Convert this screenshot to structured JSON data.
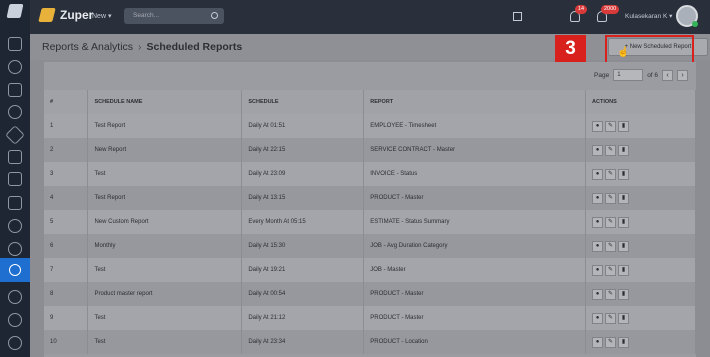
{
  "topbar": {
    "brand": "Zuper",
    "new_label": "New ▾",
    "search_placeholder": "Search...",
    "notif_count_1": "14",
    "notif_count_2": "2000",
    "user_name": "Kulasekaran K ▾"
  },
  "header": {
    "breadcrumb_root": "Reports & Analytics",
    "separator": "›",
    "page_title": "Scheduled Reports",
    "new_button_label": "+ New Scheduled Report"
  },
  "annotation": {
    "step": "3"
  },
  "pagination": {
    "label": "Page",
    "current": "1",
    "total": "of 6"
  },
  "table": {
    "columns": [
      "#",
      "SCHEDULE NAME",
      "SCHEDULE",
      "REPORT",
      "ACTIONS"
    ],
    "rows": [
      {
        "num": "1",
        "name": "Test Report",
        "schedule": "Daily At 01:51",
        "report": "EMPLOYEE - Timesheet"
      },
      {
        "num": "2",
        "name": "New Report",
        "schedule": "Daily At 22:15",
        "report": "SERVICE CONTRACT - Master"
      },
      {
        "num": "3",
        "name": "Test",
        "schedule": "Daily At 23:09",
        "report": "INVOICE - Status"
      },
      {
        "num": "4",
        "name": "Test Report",
        "schedule": "Daily At 13:15",
        "report": "PRODUCT - Master"
      },
      {
        "num": "5",
        "name": "New Custom Report",
        "schedule": "Every Month At 05:15",
        "report": "ESTIMATE - Status Summary"
      },
      {
        "num": "6",
        "name": "Monthly",
        "schedule": "Daily At 15:30",
        "report": "JOB - Avg Duration Category"
      },
      {
        "num": "7",
        "name": "Test",
        "schedule": "Daily At 19:21",
        "report": "JOB - Master"
      },
      {
        "num": "8",
        "name": "Product master report",
        "schedule": "Daily At 00:54",
        "report": "PRODUCT - Master"
      },
      {
        "num": "9",
        "name": "Test",
        "schedule": "Daily At 21:12",
        "report": "PRODUCT - Master"
      },
      {
        "num": "10",
        "name": "Test",
        "schedule": "Daily At 23:34",
        "report": "PRODUCT - Location"
      }
    ]
  },
  "icons": {
    "view": "eye-icon",
    "edit": "pencil-icon",
    "delete": "trash-icon",
    "view_glyph": "●",
    "edit_glyph": "✎",
    "delete_glyph": "▮",
    "prev_glyph": "‹",
    "next_glyph": "›"
  },
  "colors": {
    "accent_red": "#d8211d",
    "active_nav": "#1f6fd1"
  }
}
